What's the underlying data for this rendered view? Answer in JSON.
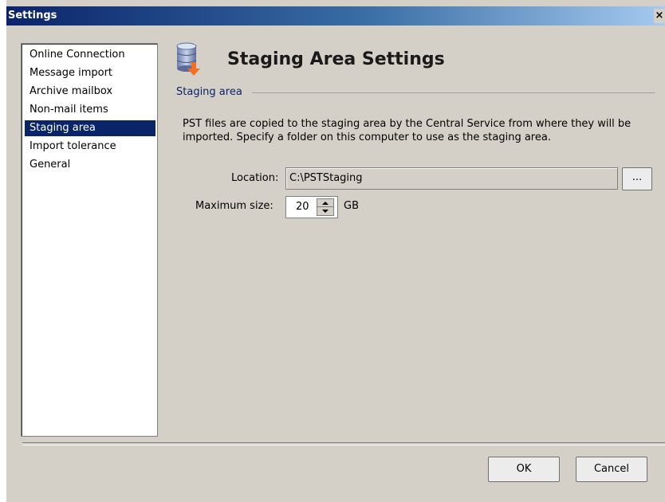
{
  "window": {
    "title": "Settings",
    "close_glyph": "×"
  },
  "nav": {
    "items": [
      {
        "label": "Online Connection",
        "selected": false
      },
      {
        "label": "Message import",
        "selected": false
      },
      {
        "label": "Archive mailbox",
        "selected": false
      },
      {
        "label": "Non-mail items",
        "selected": false
      },
      {
        "label": "Staging area",
        "selected": true
      },
      {
        "label": "Import tolerance",
        "selected": false
      },
      {
        "label": "General",
        "selected": false
      }
    ]
  },
  "header": {
    "icon": "database-download-icon",
    "title": "Staging Area Settings"
  },
  "group": {
    "label": "Staging area",
    "description": "PST files are copied to the staging area by the Central Service from where they will be imported. Specify a folder on this computer to use as the staging area."
  },
  "location": {
    "label": "Location:",
    "value": "C:\\PSTStaging",
    "browse_label": "..."
  },
  "max_size": {
    "label": "Maximum size:",
    "value": "20",
    "unit": "GB"
  },
  "buttons": {
    "ok": "OK",
    "cancel": "Cancel"
  },
  "colors": {
    "selection": "#0a246a",
    "dialog_bg": "#d4d0c8",
    "icon_accent": "#f36f21"
  }
}
